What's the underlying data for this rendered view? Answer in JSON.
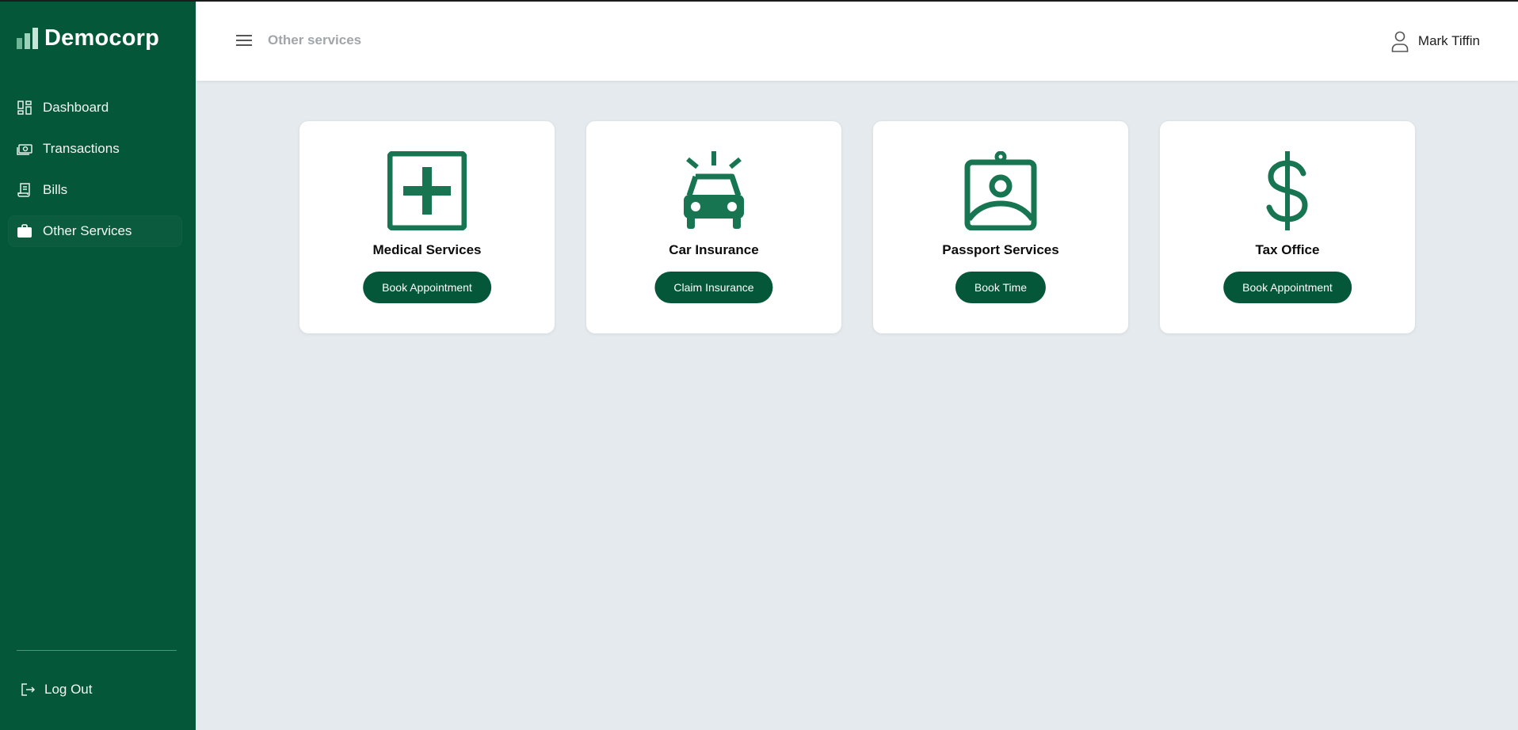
{
  "brand": {
    "name": "Democorp",
    "logo_icon": "bar-chart-logo"
  },
  "sidebar": {
    "items": [
      {
        "label": "Dashboard",
        "icon": "dashboard-icon"
      },
      {
        "label": "Transactions",
        "icon": "cash-icon"
      },
      {
        "label": "Bills",
        "icon": "receipt-icon"
      },
      {
        "label": "Other Services",
        "icon": "briefcase-icon",
        "active": true
      }
    ],
    "logout_label": "Log Out"
  },
  "header": {
    "breadcrumb": "Other services",
    "user_name": "Mark Tiffin"
  },
  "services": [
    {
      "title": "Medical Services",
      "button": "Book Appointment",
      "icon": "medical-cross-icon"
    },
    {
      "title": "Car Insurance",
      "button": "Claim Insurance",
      "icon": "car-alert-icon"
    },
    {
      "title": "Passport Services",
      "button": "Book Time",
      "icon": "id-badge-icon"
    },
    {
      "title": "Tax Office",
      "button": "Book Appointment",
      "icon": "dollar-icon"
    }
  ],
  "colors": {
    "sidebar_bg": "#05573a",
    "accent": "#05573a",
    "icon_green": "#177552",
    "page_bg": "#e5eaee"
  }
}
